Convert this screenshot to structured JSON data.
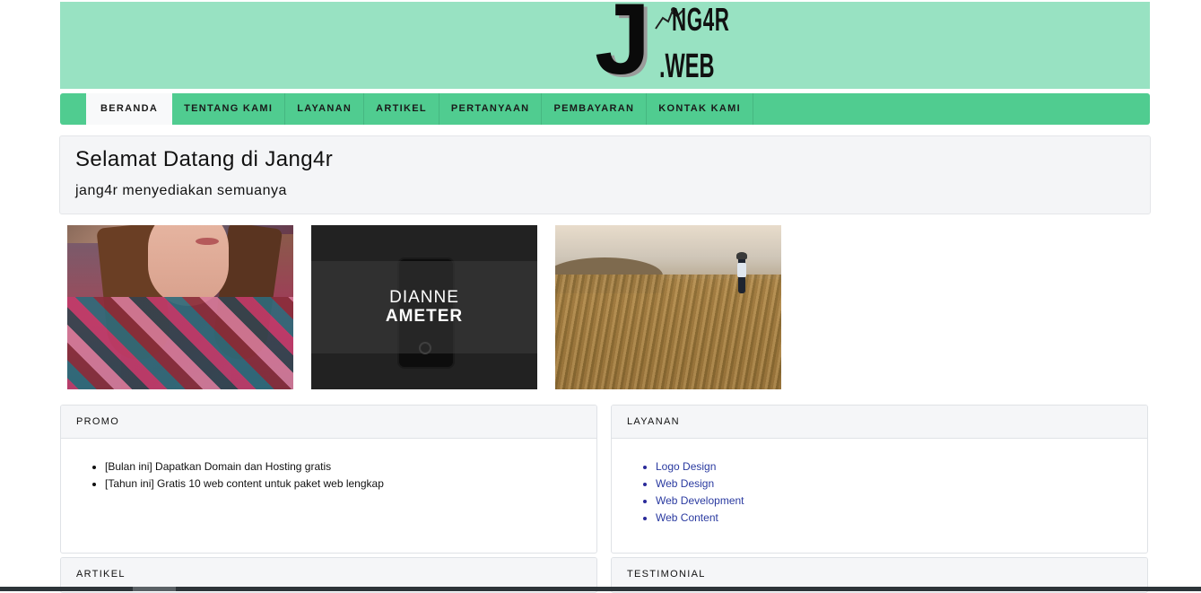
{
  "header": {
    "logo": {
      "letter": "J",
      "top_text": "NG4R",
      "bottom_text": ".WEB"
    },
    "background_color": "#98e2c2"
  },
  "navbar": {
    "background_color": "#50cc90",
    "items": [
      {
        "label": "BERANDA",
        "active": true
      },
      {
        "label": "TENTANG KAMI"
      },
      {
        "label": "LAYANAN"
      },
      {
        "label": "ARTIKEL"
      },
      {
        "label": "PERTANYAAN"
      },
      {
        "label": "PEMBAYARAN"
      },
      {
        "label": "KONTAK KAMI"
      }
    ]
  },
  "jumbotron": {
    "title": "Selamat Datang di Jang4r",
    "subtitle": "jang4r menyediakan semuanya"
  },
  "gallery": {
    "images": [
      {
        "name": "woman-in-poncho"
      },
      {
        "name": "phone-photo",
        "title_line1": "DIANNE",
        "title_line2": "AMETER"
      },
      {
        "name": "person-in-field"
      }
    ]
  },
  "cards": {
    "promo": {
      "header": "PROMO",
      "items": [
        "[Bulan ini] Dapatkan Domain dan Hosting gratis",
        "[Tahun ini] Gratis 10 web content untuk paket web lengkap"
      ]
    },
    "layanan": {
      "header": "LAYANAN",
      "items": [
        "Logo Design",
        "Web Design",
        "Web Development",
        "Web Content"
      ]
    },
    "artikel": {
      "header": "ARTIKEL"
    },
    "testimonial": {
      "header": "TESTIMONIAL"
    }
  }
}
